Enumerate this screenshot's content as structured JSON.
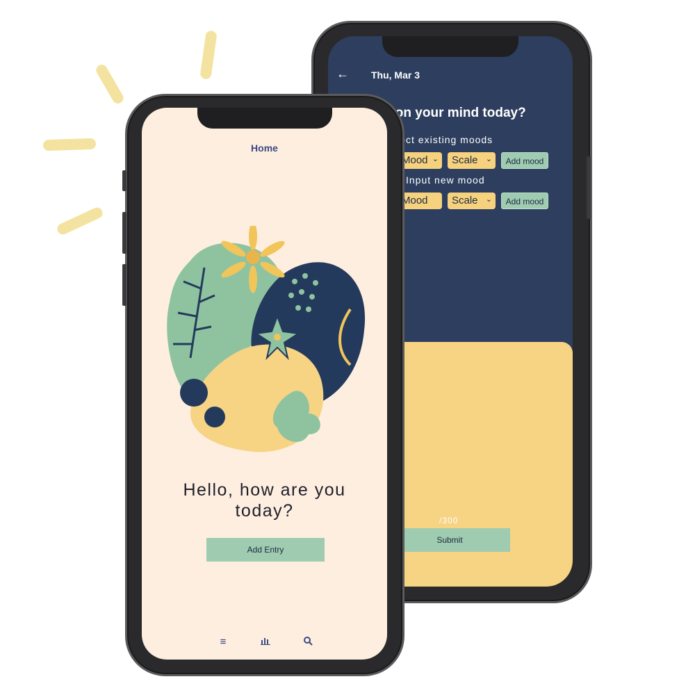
{
  "back_screen": {
    "back_icon": "arrow-left-icon",
    "date": "Thu, Mar 3",
    "question": "What's on your mind today?",
    "select_heading": "Select existing moods",
    "input_heading": "Input new mood",
    "mood_select_value": "Mood",
    "scale_select_value": "Scale",
    "mood_input_value": "Mood",
    "scale_select_value_2": "Scale",
    "add_mood_label": "Add mood",
    "add_mood_label_2": "Add mood",
    "counter": "/300",
    "submit_label": "Submit",
    "colors": {
      "background": "#2d3e5e",
      "card": "#f7d384",
      "button": "#9fcbb0",
      "select": "#f7d27e"
    }
  },
  "front_screen": {
    "title": "Home",
    "greeting": "Hello, how are you today?",
    "add_entry_label": "Add Entry",
    "nav": [
      {
        "icon": "menu-icon",
        "glyph": "≡"
      },
      {
        "icon": "chart-icon",
        "glyph": "📊"
      },
      {
        "icon": "search-icon",
        "glyph": "🔍"
      }
    ],
    "colors": {
      "background": "#feeee0",
      "title": "#3a4a82",
      "button": "#9fcbb0"
    }
  }
}
